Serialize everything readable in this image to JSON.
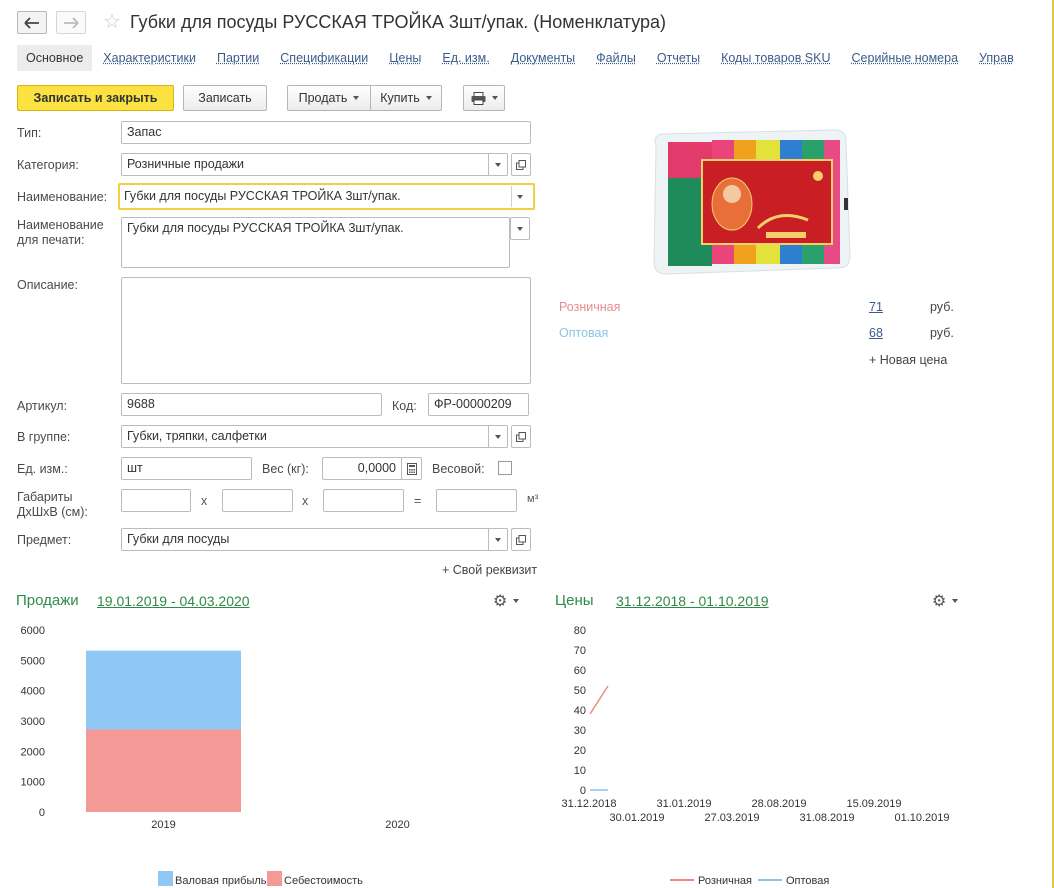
{
  "window": {
    "title": "Губки для посуды РУССКАЯ ТРОЙКА 3шт/упак. (Номенклатура)"
  },
  "icons": {
    "back": "arrow-left-icon",
    "forward": "arrow-right-icon",
    "favorite": "star-icon",
    "print": "printer-icon",
    "settings": "gear-icon",
    "open": "open-form-icon",
    "calculator": "calculator-icon"
  },
  "tabs": [
    {
      "label": "Основное",
      "active": true
    },
    {
      "label": "Характеристики"
    },
    {
      "label": "Партии"
    },
    {
      "label": "Спецификации"
    },
    {
      "label": "Цены"
    },
    {
      "label": "Ед. изм."
    },
    {
      "label": "Документы"
    },
    {
      "label": "Файлы"
    },
    {
      "label": "Отчеты"
    },
    {
      "label": "Коды товаров SKU"
    },
    {
      "label": "Серийные номера"
    },
    {
      "label": "Управ"
    }
  ],
  "toolbar": {
    "save_close": "Записать и закрыть",
    "save": "Записать",
    "sell": "Продать",
    "buy": "Купить"
  },
  "form": {
    "type_label": "Тип:",
    "type_value": "Запас",
    "category_label": "Категория:",
    "category_value": "Розничные продажи",
    "name_label": "Наименование:",
    "name_value": "Губки для посуды РУССКАЯ ТРОЙКА 3шт/упак.",
    "print_name_label_1": "Наименование",
    "print_name_label_2": "для печати:",
    "print_name_value": "Губки для посуды РУССКАЯ ТРОЙКА 3шт/упак.",
    "description_label": "Описание:",
    "description_value": "",
    "article_label": "Артикул:",
    "article_value": "9688",
    "code_label": "Код:",
    "code_value": "ФР-00000209",
    "group_label": "В группе:",
    "group_value": "Губки, тряпки, салфетки",
    "unit_label": "Ед. изм.:",
    "unit_value": "шт",
    "weight_label": "Вес (кг):",
    "weight_value": "0,0000",
    "weighted_label": "Весовой:",
    "weighted_checked": false,
    "dims_label_1": "Габариты",
    "dims_label_2": "ДхШхВ (см):",
    "dims_x": "x",
    "dims_eq": "=",
    "dims_unit": "м³",
    "subject_label": "Предмет:",
    "subject_value": "Губки для посуды",
    "custom_attr": "+ Свой реквизит"
  },
  "prices": {
    "retail_label": "Розничная",
    "retail_value": "71",
    "retail_currency": "руб.",
    "wholesale_label": "Оптовая",
    "wholesale_value": "68",
    "wholesale_currency": "руб.",
    "new_price": "+ Новая цена",
    "retail_color": "#e98c8c",
    "wholesale_color": "#8cc4e6"
  },
  "sales": {
    "title": "Продажи",
    "period": "19.01.2019 - 04.03.2020"
  },
  "price_history": {
    "title": "Цены",
    "period": "31.12.2018 - 01.10.2019"
  },
  "chart_data": [
    {
      "type": "bar",
      "stacked": true,
      "categories": [
        "2019",
        "2020"
      ],
      "series": [
        {
          "name": "Себестоимость",
          "values": [
            2720,
            0
          ],
          "color": "#f49a96"
        },
        {
          "name": "Валовая прибыль",
          "values": [
            2600,
            0
          ],
          "color": "#8fc8f4"
        }
      ],
      "ylim": [
        0,
        6000
      ],
      "yticks": [
        "6000",
        "5000",
        "4000",
        "3000",
        "2000",
        "1000",
        "0"
      ],
      "legend": "bottom"
    },
    {
      "type": "line",
      "x_ticks_top": [
        "31.12.2018",
        "31.01.2019",
        "28.08.2019",
        "15.09.2019"
      ],
      "x_ticks_bottom": [
        "30.01.2019",
        "27.03.2019",
        "31.08.2019",
        "01.10.2019"
      ],
      "series": [
        {
          "name": "Розничная",
          "points": [
            [
              0,
              38
            ],
            [
              0.5,
              52
            ]
          ],
          "color": "#f08a80"
        },
        {
          "name": "Оптовая",
          "points": [
            [
              0,
              0
            ],
            [
              0.5,
              0
            ]
          ],
          "color": "#8cc4e6"
        }
      ],
      "ylim": [
        0,
        80
      ],
      "yticks": [
        "80",
        "70",
        "60",
        "50",
        "40",
        "30",
        "20",
        "10",
        "0"
      ],
      "legend": "bottom"
    }
  ]
}
